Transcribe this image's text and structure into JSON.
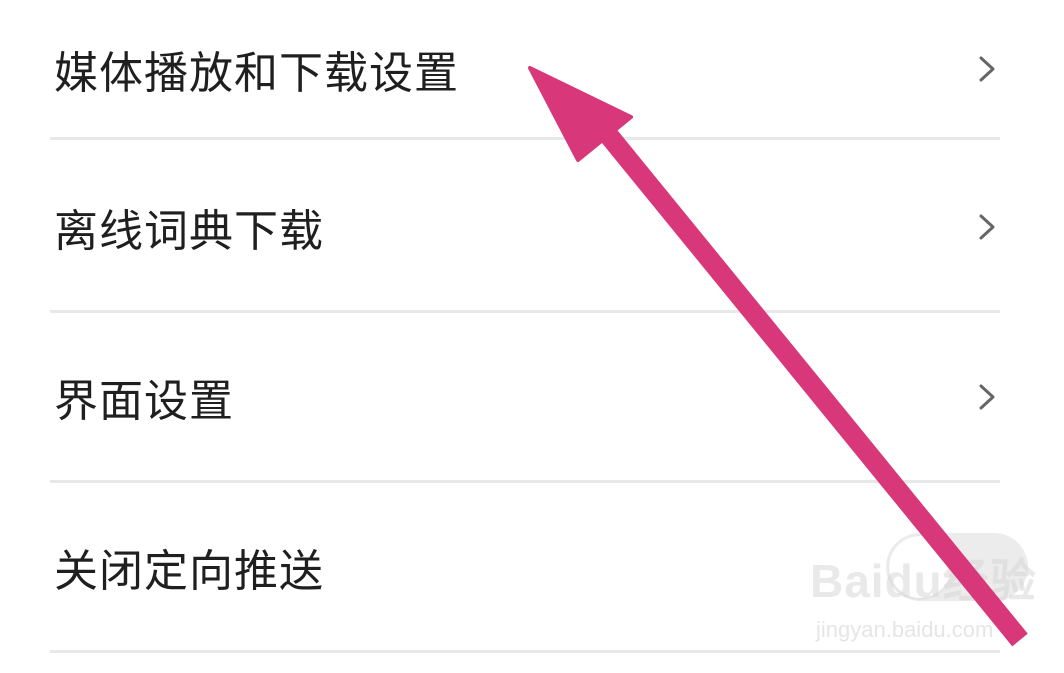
{
  "settings": {
    "items": [
      {
        "label": "媒体播放和下载设置",
        "control": "chevron"
      },
      {
        "label": "离线词典下载",
        "control": "chevron"
      },
      {
        "label": "界面设置",
        "control": "chevron"
      },
      {
        "label": "关闭定向推送",
        "control": "toggle",
        "toggle_on": false
      }
    ]
  },
  "annotation": {
    "arrow_color": "#d8387a",
    "arrow_icon": "arrow-annotation-icon"
  },
  "watermark": {
    "logo_text": "Baidu经验",
    "url": "jingyan.baidu.com"
  },
  "colors": {
    "text": "#1f1f1f",
    "divider": "#e8e8e8",
    "chevron": "#666666",
    "toggle_track": "#ececec"
  }
}
